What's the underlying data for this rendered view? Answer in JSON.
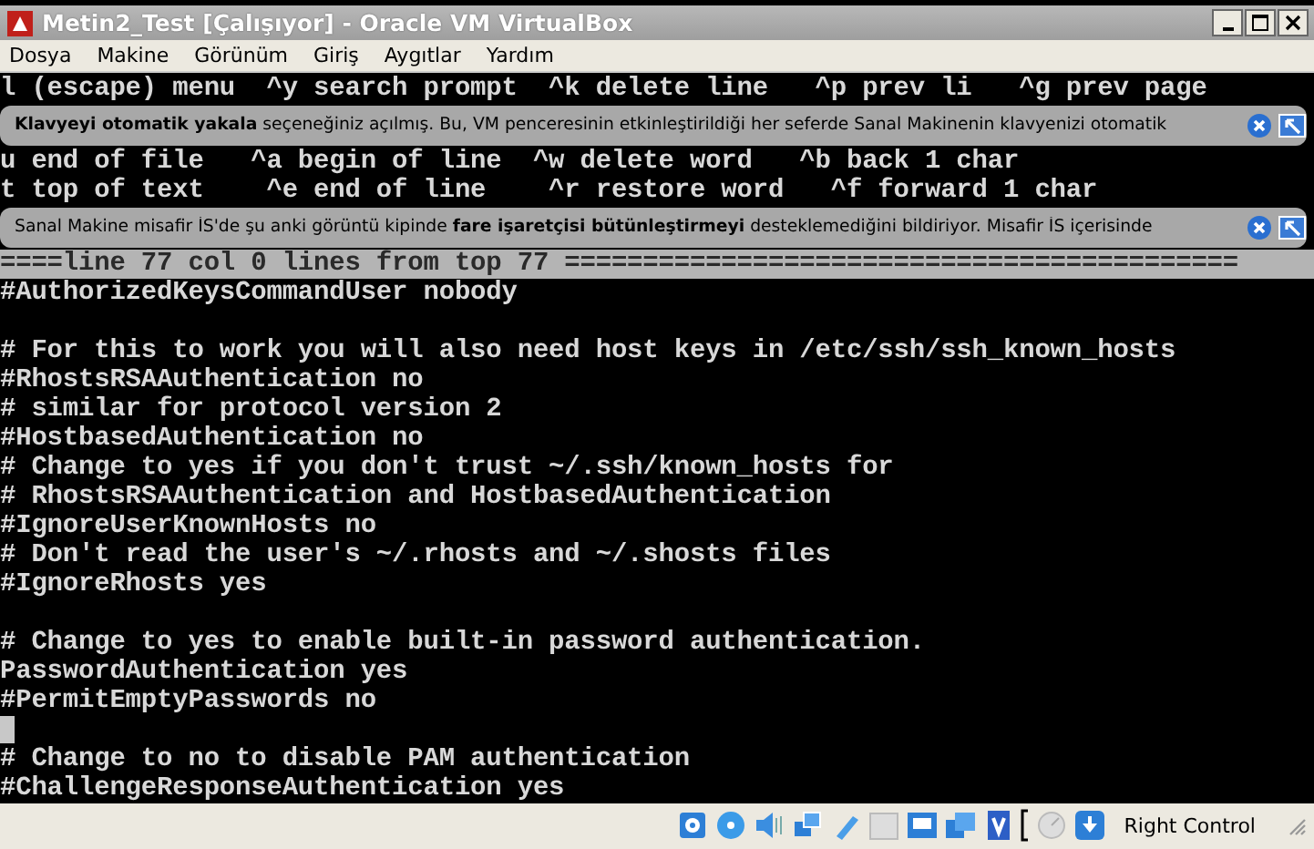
{
  "window": {
    "title": "Metin2_Test [Çalışıyor] - Oracle VM VirtualBox"
  },
  "menu": [
    "Dosya",
    "Makine",
    "Görünüm",
    "Giriş",
    "Aygıtlar",
    "Yardım"
  ],
  "terminal": {
    "rows": [
      {
        "kind": "help",
        "text": "l (escape) menu  ^y search prompt  ^k delete line   ^p prev li   ^g prev page"
      },
      {
        "kind": "banner",
        "text": "**Klavyeyi otomatik yakala** seçeneğiniz açılmış. Bu, VM penceresinin etkinleştirildiği her seferde Sanal Makinenin klavyenizi otomatik"
      },
      {
        "kind": "help",
        "text": "u end of file   ^a begin of line  ^w delete word   ^b back 1 char"
      },
      {
        "kind": "help",
        "text": "t top of text    ^e end of line    ^r restore word   ^f forward 1 char"
      },
      {
        "kind": "banner",
        "text": "Sanal Makine misafir İS'de şu anki görüntü kipinde **fare işaretçisi bütünleştirmeyi** desteklemediğini bildiriyor. Misafir İS içerisinde"
      },
      {
        "kind": "status",
        "text": "====line 77 col 0 lines from top 77 ==========================================="
      },
      {
        "kind": "text",
        "text": "#AuthorizedKeysCommandUser nobody"
      },
      {
        "kind": "blank"
      },
      {
        "kind": "text",
        "text": "# For this to work you will also need host keys in /etc/ssh/ssh_known_hosts"
      },
      {
        "kind": "text",
        "text": "#RhostsRSAAuthentication no"
      },
      {
        "kind": "text",
        "text": "# similar for protocol version 2"
      },
      {
        "kind": "text",
        "text": "#HostbasedAuthentication no"
      },
      {
        "kind": "text",
        "text": "# Change to yes if you don't trust ~/.ssh/known_hosts for"
      },
      {
        "kind": "text",
        "text": "# RhostsRSAAuthentication and HostbasedAuthentication"
      },
      {
        "kind": "text",
        "text": "#IgnoreUserKnownHosts no"
      },
      {
        "kind": "text",
        "text": "# Don't read the user's ~/.rhosts and ~/.shosts files"
      },
      {
        "kind": "text",
        "text": "#IgnoreRhosts yes"
      },
      {
        "kind": "blank"
      },
      {
        "kind": "text",
        "text": "# Change to yes to enable built-in password authentication."
      },
      {
        "kind": "text",
        "text": "PasswordAuthentication yes"
      },
      {
        "kind": "text",
        "text": "#PermitEmptyPasswords no"
      },
      {
        "kind": "cursor"
      },
      {
        "kind": "text",
        "text": "# Change to no to disable PAM authentication"
      },
      {
        "kind": "text",
        "text": "#ChallengeResponseAuthentication yes"
      }
    ]
  },
  "status_bar": {
    "host_key": "Right Control"
  }
}
